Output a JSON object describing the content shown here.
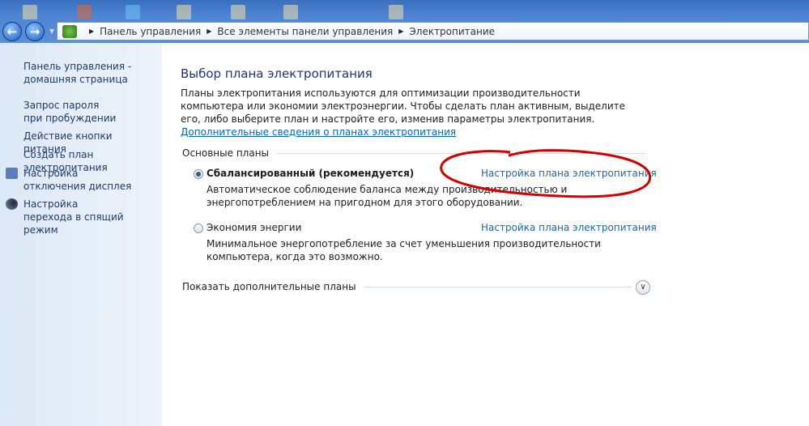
{
  "address_bar": {
    "crumbs": [
      "Панель управления",
      "Все элементы панели управления",
      "Электропитание"
    ]
  },
  "sidebar": {
    "items": [
      {
        "label": "Панель управления - домашняя страница"
      },
      {
        "label": "Запрос пароля при пробуждении"
      },
      {
        "label": "Действие кнопки питания"
      },
      {
        "label": "Создать план электропитания"
      },
      {
        "label": "Настройка отключения дисплея",
        "icon": "display-clock-icon"
      },
      {
        "label": "Настройка перехода в спящий режим",
        "icon": "moon-icon"
      }
    ]
  },
  "main": {
    "title": "Выбор плана электропитания",
    "intro": "Планы электропитания используются для оптимизации производительности компьютера или экономии электроэнергии. Чтобы сделать план активным, выделите его, либо выберите план и настройте его, изменив параметры электропитания.",
    "intro_link": "Дополнительные сведения о планах электропитания",
    "group_label": "Основные планы",
    "plans": [
      {
        "name": "Сбалансированный (рекомендуется)",
        "selected": true,
        "link": "Настройка плана электропитания",
        "desc": "Автоматическое соблюдение баланса между производительностью и энергопотреблением на пригодном для этого оборудовании."
      },
      {
        "name": "Экономия энергии",
        "selected": false,
        "link": "Настройка плана электропитания",
        "desc": "Минимальное энергопотребление за счет уменьшения производительности компьютера, когда это возможно."
      }
    ],
    "more_plans": "Показать дополнительные планы"
  },
  "annotation_color": "#d40000"
}
